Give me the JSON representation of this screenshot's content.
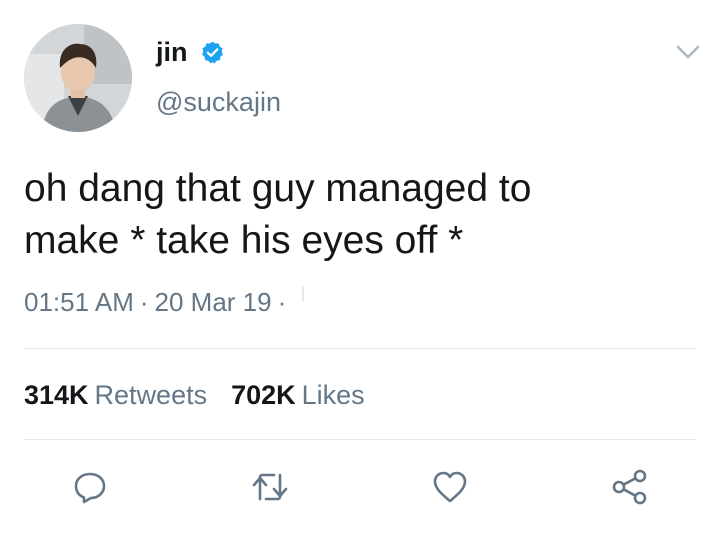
{
  "author": {
    "name": "jin",
    "handle": "@suckajin",
    "verified": true,
    "verified_badge_icon": "verified-badge-icon",
    "badge_color": "#1da1f2"
  },
  "menu_icon": "chevron-down-icon",
  "tweet": {
    "text_line1": "oh dang that guy managed to",
    "text_line2": "make * take his eyes off *"
  },
  "meta": {
    "time": "01:51 AM",
    "separator": "·",
    "date": "20 Mar 19",
    "trailing_separator": "·"
  },
  "stats": {
    "retweets_count": "314K",
    "retweets_label": "Retweets",
    "likes_count": "702K",
    "likes_label": "Likes"
  },
  "actions": [
    {
      "name": "reply",
      "icon": "reply-icon"
    },
    {
      "name": "retweet",
      "icon": "retweet-icon"
    },
    {
      "name": "like",
      "icon": "heart-icon"
    },
    {
      "name": "share",
      "icon": "share-icon"
    }
  ],
  "colors": {
    "text_primary": "#14171a",
    "text_secondary": "#657786",
    "divider": "#e1e8ed",
    "icon": "#657786"
  }
}
